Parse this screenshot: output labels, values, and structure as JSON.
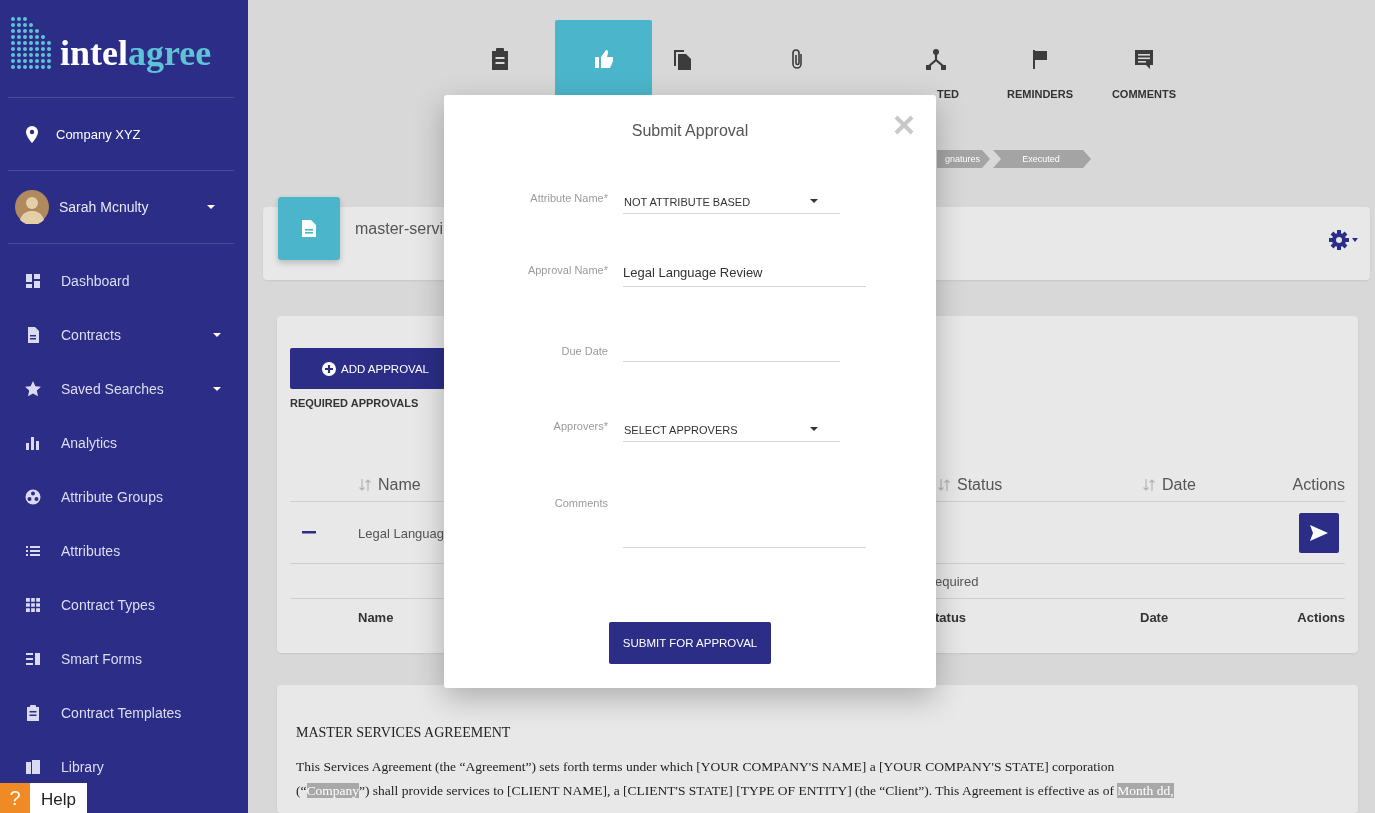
{
  "sidebar": {
    "logo": {
      "primary": "intel",
      "accent": "agree"
    },
    "company": "Company XYZ",
    "user": {
      "name": "Sarah Mcnulty",
      "has_menu": true
    },
    "nav": [
      {
        "label": "Dashboard",
        "has_menu": false
      },
      {
        "label": "Contracts",
        "has_menu": true
      },
      {
        "label": "Saved Searches",
        "has_menu": true
      },
      {
        "label": "Analytics",
        "has_menu": false
      },
      {
        "label": "Attribute Groups",
        "has_menu": false
      },
      {
        "label": "Attributes",
        "has_menu": false
      },
      {
        "label": "Contract Types",
        "has_menu": false
      },
      {
        "label": "Smart Forms",
        "has_menu": false
      },
      {
        "label": "Contract Templates",
        "has_menu": false
      },
      {
        "label": "Library",
        "has_menu": false
      }
    ]
  },
  "help": {
    "icon": "?",
    "label": "Help"
  },
  "tabs": [
    {
      "selected": false
    },
    {
      "selected": true
    },
    {
      "selected": false
    },
    {
      "selected": false
    },
    {
      "selected": false,
      "label": "TED",
      "label_cut": true
    },
    {
      "selected": false,
      "label": "REMINDERS",
      "label_cut": false
    },
    {
      "selected": false,
      "label": "COMMENTS",
      "label_cut": false
    }
  ],
  "stages": [
    "gnatures",
    "Executed"
  ],
  "document_header": {
    "title": "master-servi"
  },
  "approvals": {
    "add_button": "ADD APPROVAL",
    "section_title": "REQUIRED APPROVALS",
    "columns": [
      {
        "label": "Name",
        "sortable": true
      },
      {
        "label": "Status",
        "sortable": true
      },
      {
        "label": "Date",
        "sortable": true
      },
      {
        "label": "Actions",
        "sortable": false
      }
    ],
    "rows": [
      {
        "name": "Legal Languag"
      }
    ],
    "group_label": "equired",
    "footer": [
      "Name",
      "tatus",
      "Date",
      "Actions"
    ]
  },
  "modal": {
    "title": "Submit Approval",
    "fields": [
      {
        "label": "Attribute Name*",
        "kind": "select",
        "value": "NOT ATTRIBUTE BASED"
      },
      {
        "label": "Approval Name*",
        "kind": "text",
        "value": "Legal Language Review"
      },
      {
        "label": "Due Date",
        "kind": "date"
      },
      {
        "label": "Approvers*",
        "kind": "select",
        "value": "SELECT APPROVERS"
      },
      {
        "label": "Comments",
        "kind": "textarea"
      }
    ],
    "submit": "SUBMIT FOR APPROVAL"
  },
  "agreement": {
    "title": "MASTER SERVICES AGREEMENT",
    "lines": [
      [
        {
          "text": "This Services Agreement (the “Agreement”) sets forth terms under which [YOUR COMPANY'S NAME] a [YOUR COMPANY'S STATE] corporation",
          "blank": false
        }
      ],
      [
        {
          "text": "(“",
          "blank": false
        },
        {
          "text": "Company",
          "blank": true
        },
        {
          "text": "”) shall provide services to [CLIENT NAME], a [CLIENT'S STATE] [TYPE OF ENTITY] (the “Client”). This Agreement is effective as of ",
          "blank": false
        },
        {
          "text": "Month dd,",
          "blank": true
        }
      ]
    ]
  }
}
